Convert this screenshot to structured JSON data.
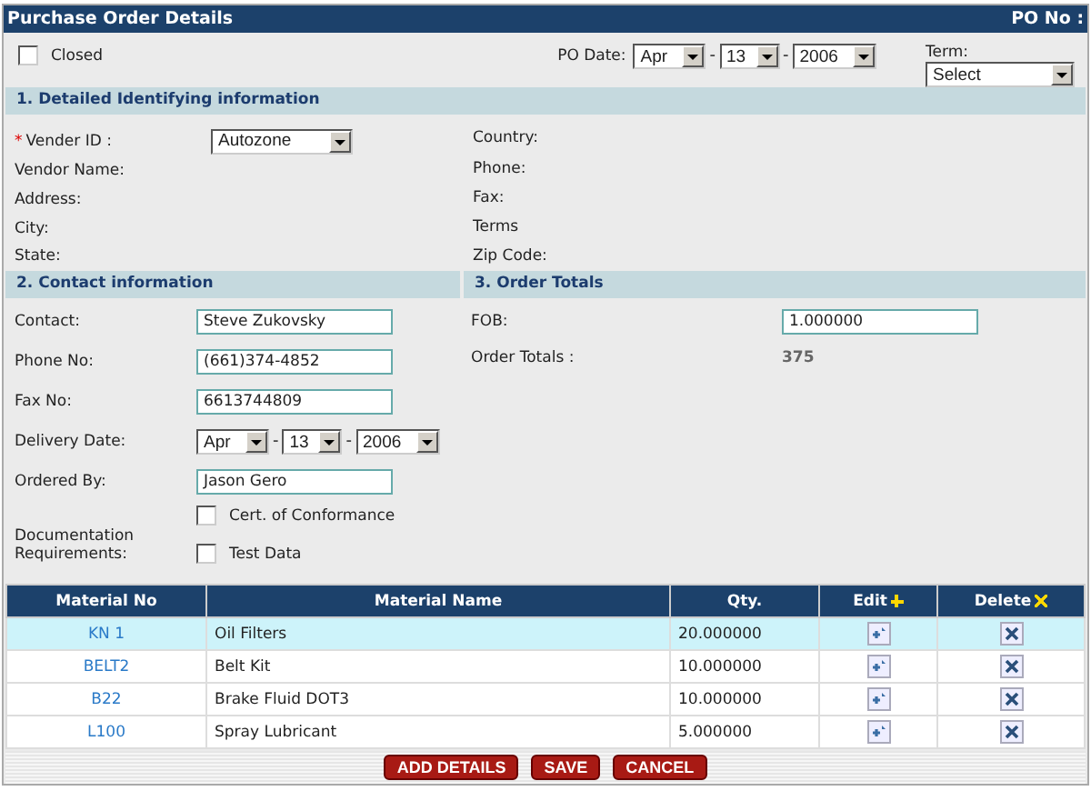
{
  "header": {
    "title": "Purchase Order Details",
    "po_label": "PO No :"
  },
  "closed": {
    "label": "Closed",
    "checked": false
  },
  "po_date": {
    "label": "PO Date:",
    "month": "Apr",
    "separator": "-",
    "day": "13",
    "separator_2": "-",
    "year": "2006"
  },
  "term": {
    "label": "Term:",
    "value": "Select"
  },
  "section1": {
    "title": "1. Detailed Identifying information",
    "vendor_id": {
      "required_mark": "*",
      "label": "Vender ID :",
      "value": "Autozone"
    },
    "left_fields": [
      "Vendor Name:",
      "Address:",
      "City:",
      "State:"
    ],
    "right_fields": [
      "Country:",
      "Phone:",
      "Fax:",
      "Terms",
      "Zip Code:"
    ]
  },
  "section2": {
    "title": "2. Contact information",
    "fields": [
      {
        "kind": "text",
        "label": "Contact:",
        "value": "Steve Zukovsky"
      },
      {
        "kind": "text",
        "label": "Phone No:",
        "value": "(661)374-4852"
      },
      {
        "kind": "text",
        "label": "Fax No:",
        "value": "6613744809"
      },
      {
        "kind": "date",
        "label": "Delivery Date:",
        "month": "Apr",
        "separator": "-",
        "day": "13",
        "separator_2": "-",
        "year": "2006"
      },
      {
        "kind": "text",
        "label": "Ordered By:",
        "value": "Jason Gero"
      }
    ],
    "documentation": {
      "label": "Documentation Requirements:",
      "options": [
        {
          "label": "Cert. of Conformance",
          "checked": false
        },
        {
          "label": "Test Data",
          "checked": false
        }
      ]
    }
  },
  "section3": {
    "title": "3. Order Totals",
    "fob": {
      "label": "FOB:",
      "value": "1.000000"
    },
    "order_totals": {
      "label": "Order Totals :",
      "value": "375"
    }
  },
  "table": {
    "columns": [
      {
        "label": "Material No",
        "kind": "text"
      },
      {
        "label": "Material Name",
        "kind": "text"
      },
      {
        "label": "Qty.",
        "kind": "text"
      },
      {
        "label": "Edit",
        "kind": "edit"
      },
      {
        "label": "Delete",
        "kind": "delete"
      }
    ],
    "rows": [
      {
        "material_no": "KN 1",
        "material_name": "Oil Filters",
        "qty": "20.000000",
        "selected": true
      },
      {
        "material_no": "BELT2",
        "material_name": "Belt Kit",
        "qty": "10.000000",
        "selected": false
      },
      {
        "material_no": "B22",
        "material_name": "Brake Fluid DOT3",
        "qty": "10.000000",
        "selected": false
      },
      {
        "material_no": "L100",
        "material_name": "Spray Lubricant",
        "qty": "5.000000",
        "selected": false
      }
    ]
  },
  "buttons": [
    "ADD DETAILS",
    "SAVE",
    "CANCEL"
  ]
}
